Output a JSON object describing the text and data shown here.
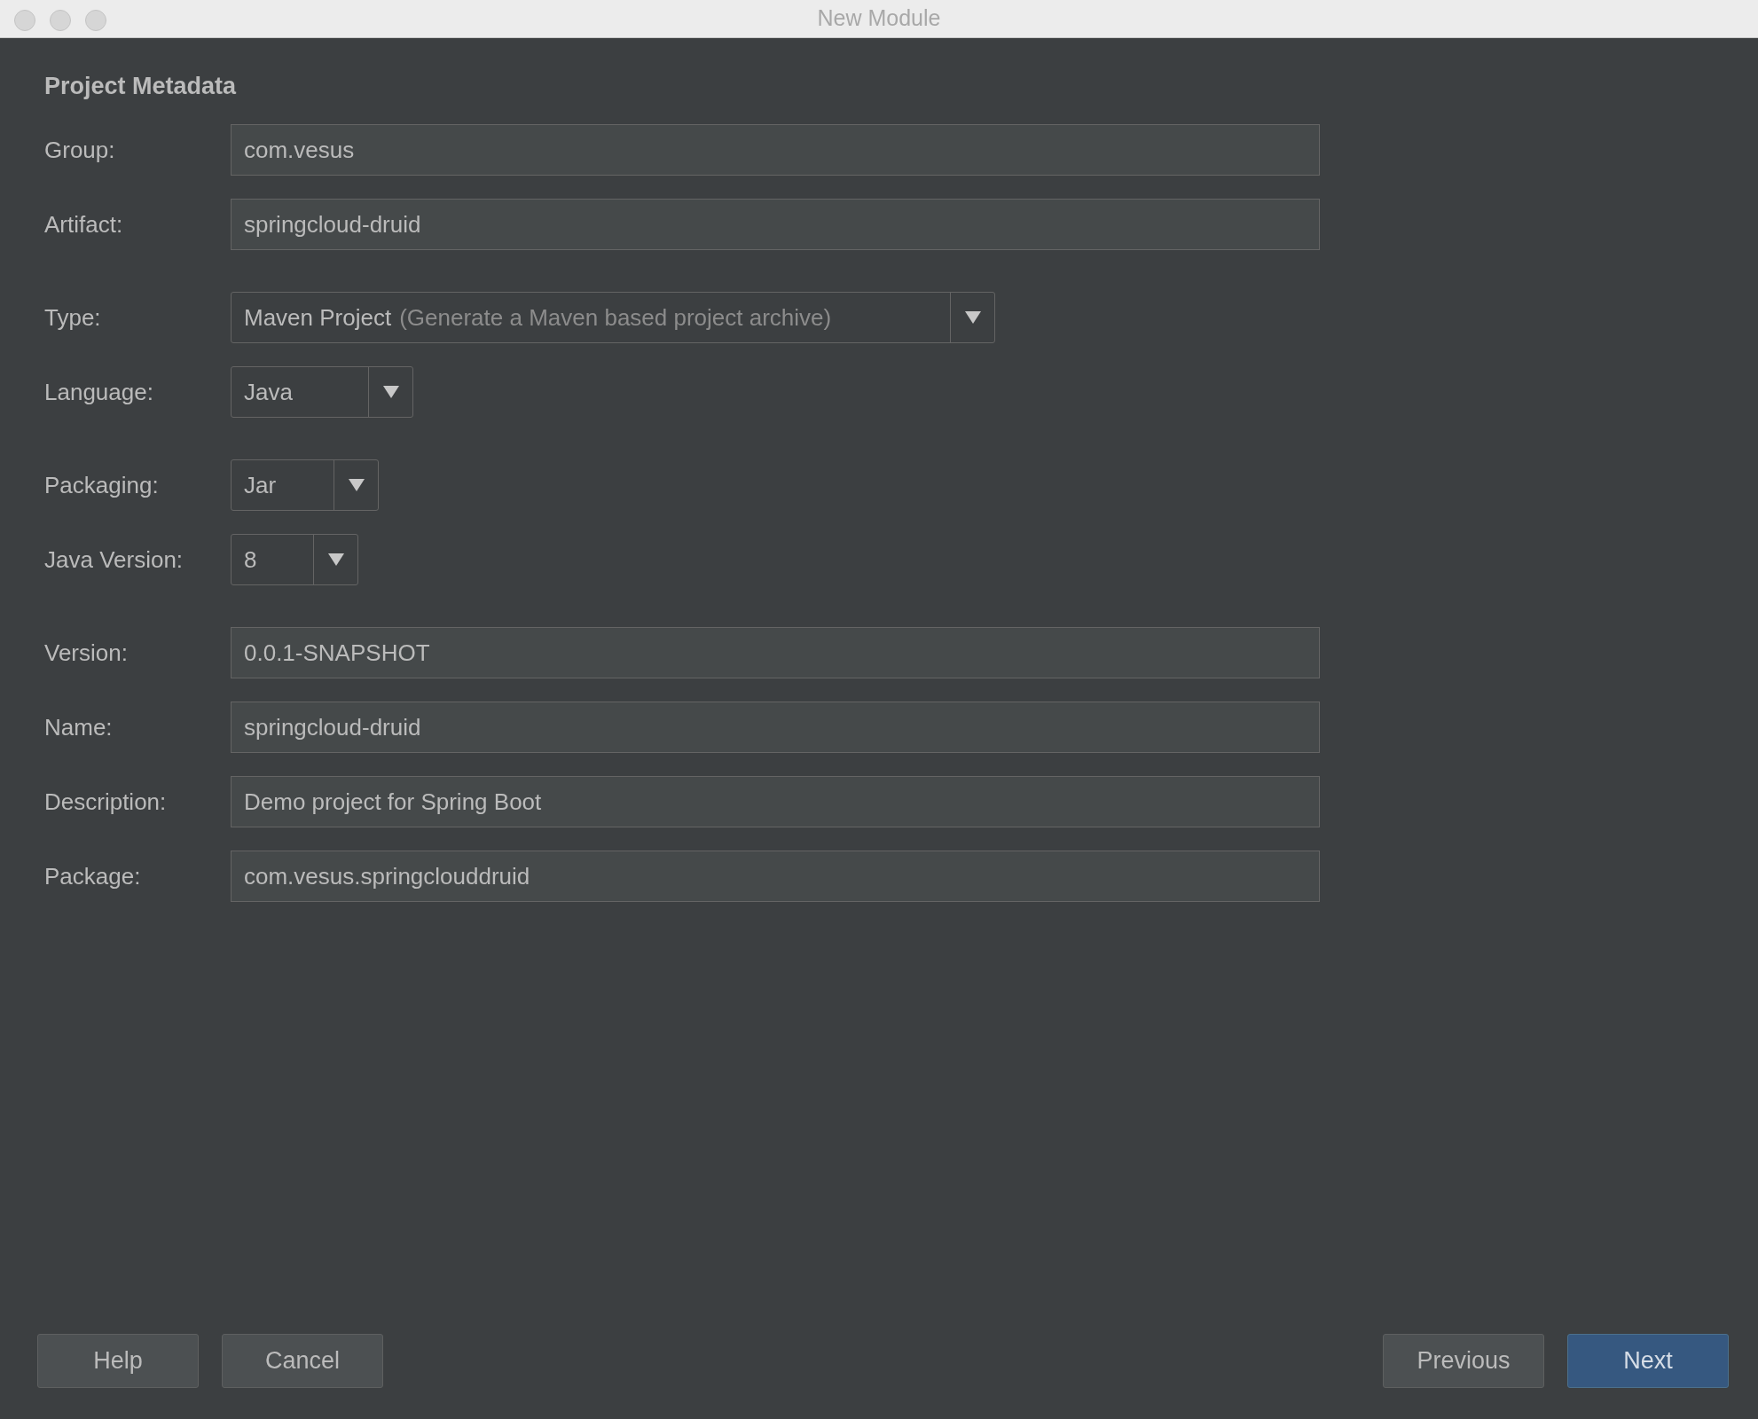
{
  "window": {
    "title": "New Module"
  },
  "section_title": "Project Metadata",
  "groups": [
    [
      {
        "kind": "text",
        "label": "Group:",
        "value": "com.vesus"
      },
      {
        "kind": "text",
        "label": "Artifact:",
        "value": "springcloud-druid"
      }
    ],
    [
      {
        "kind": "dropdown",
        "label": "Type:",
        "value": "Maven Project",
        "hint": "(Generate a Maven based project archive)"
      },
      {
        "kind": "dropdown",
        "label": "Language:",
        "value": "Java"
      }
    ],
    [
      {
        "kind": "dropdown",
        "label": "Packaging:",
        "value": "Jar"
      },
      {
        "kind": "dropdown",
        "label": "Java Version:",
        "value": "8"
      }
    ],
    [
      {
        "kind": "text",
        "label": "Version:",
        "value": "0.0.1-SNAPSHOT"
      },
      {
        "kind": "text",
        "label": "Name:",
        "value": "springcloud-druid"
      },
      {
        "kind": "text",
        "label": "Description:",
        "value": "Demo project for Spring Boot"
      },
      {
        "kind": "text",
        "label": "Package:",
        "value": "com.vesus.springclouddruid"
      }
    ]
  ],
  "buttons_left": [
    {
      "label": "Help",
      "default": false
    },
    {
      "label": "Cancel",
      "default": false
    }
  ],
  "buttons_right": [
    {
      "label": "Previous",
      "default": false
    },
    {
      "label": "Next",
      "default": true
    }
  ]
}
